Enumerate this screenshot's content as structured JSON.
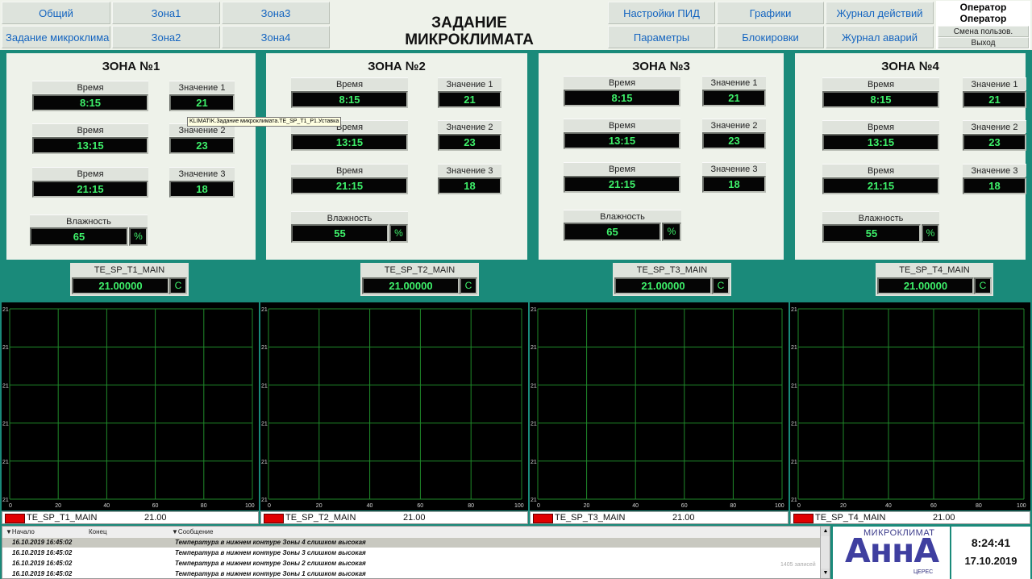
{
  "nav": {
    "general": "Общий",
    "zone1": "Зона1",
    "zone3": "Зона3",
    "microclimate_task": "Задание микроклима...",
    "zone2": "Зона2",
    "zone4": "Зона4",
    "pid_settings": "Настройки ПИД",
    "graphs": "Графики",
    "action_log": "Журнал действий",
    "parameters": "Параметры",
    "locks": "Блокировки",
    "alarm_log": "Журнал аварий"
  },
  "title": {
    "line1": "ЗАДАНИЕ",
    "line2": "МИКРОКЛИМАТА"
  },
  "user": {
    "line1": "Оператор",
    "line2": "Оператор",
    "change_user": "Смена пользов.",
    "logout": "Выход"
  },
  "labels": {
    "time": "Время",
    "value1": "Значение 1",
    "value2": "Значение 2",
    "value3": "Значение 3",
    "humidity": "Влажность",
    "percent": "%",
    "unit_c": "C"
  },
  "tooltip": "KLIMATIK.Задание микроклимата.TE_SP_T1_P1.Уставка",
  "zones": [
    {
      "title": "ЗОНА №1",
      "times": [
        "8:15",
        "13:15",
        "21:15"
      ],
      "values": [
        "21",
        "23",
        "18"
      ],
      "humidity": "65",
      "tag": "TE_SP_T1_MAIN",
      "tag_value": "21.00000",
      "legend_value": "21.00"
    },
    {
      "title": "ЗОНА №2",
      "times": [
        "8:15",
        "13:15",
        "21:15"
      ],
      "values": [
        "21",
        "23",
        "18"
      ],
      "humidity": "55",
      "tag": "TE_SP_T2_MAIN",
      "tag_value": "21.00000",
      "legend_value": "21.00"
    },
    {
      "title": "ЗОНА №3",
      "times": [
        "8:15",
        "13:15",
        "21:15"
      ],
      "values": [
        "21",
        "23",
        "18"
      ],
      "humidity": "65",
      "tag": "TE_SP_T3_MAIN",
      "tag_value": "21.00000",
      "legend_value": "21.00"
    },
    {
      "title": "ЗОНА №4",
      "times": [
        "8:15",
        "13:15",
        "21:15"
      ],
      "values": [
        "21",
        "23",
        "18"
      ],
      "humidity": "55",
      "tag": "TE_SP_T4_MAIN",
      "tag_value": "21.00000",
      "legend_value": "21.00"
    }
  ],
  "chart_data": [
    {
      "type": "line",
      "x_ticks": [
        "0",
        "20",
        "40",
        "60",
        "80",
        "100"
      ],
      "y_ticks": [
        "21",
        "21",
        "21",
        "21",
        "21",
        "21"
      ],
      "series": [
        {
          "name": "TE_SP_T1_MAIN",
          "values": []
        }
      ],
      "grid": true
    },
    {
      "type": "line",
      "x_ticks": [
        "0",
        "20",
        "40",
        "60",
        "80",
        "100"
      ],
      "y_ticks": [
        "21",
        "21",
        "21",
        "21",
        "21",
        "21"
      ],
      "series": [
        {
          "name": "TE_SP_T2_MAIN",
          "values": []
        }
      ],
      "grid": true
    },
    {
      "type": "line",
      "x_ticks": [
        "0",
        "20",
        "40",
        "60",
        "80",
        "100"
      ],
      "y_ticks": [
        "21",
        "21",
        "21",
        "21",
        "21",
        "21"
      ],
      "series": [
        {
          "name": "TE_SP_T3_MAIN",
          "values": []
        }
      ],
      "grid": true
    },
    {
      "type": "line",
      "x_ticks": [
        "0",
        "20",
        "40",
        "60",
        "80",
        "100"
      ],
      "y_ticks": [
        "21",
        "21",
        "21",
        "21",
        "21",
        "21"
      ],
      "series": [
        {
          "name": "TE_SP_T4_MAIN",
          "values": []
        }
      ],
      "grid": true
    }
  ],
  "alarms": {
    "headers": {
      "start": "Начало",
      "end": "Конец",
      "message": "Сообщение"
    },
    "rows": [
      {
        "start": "16.10.2019 16:45:02",
        "message": "Температура в нижнем контуре Зоны 4 слишком высокая"
      },
      {
        "start": "16.10.2019 16:45:02",
        "message": "Температура в нижнем контуре Зоны 3 слишком высокая"
      },
      {
        "start": "16.10.2019 16:45:02",
        "message": "Температура в нижнем контуре Зоны 2 слишком высокая"
      },
      {
        "start": "16.10.2019 16:45:02",
        "message": "Температура в нижнем контуре Зоны 1 слишком высокая"
      }
    ],
    "count": "1405",
    "count_suffix": "записей"
  },
  "logo": {
    "small": "МИКРОКЛИМАТ",
    "big": "АннА",
    "brand": "ЦЕРЕС"
  },
  "clock": {
    "time": "8:24:41",
    "date": "17.10.2019"
  },
  "colors": {
    "accent": "#1a8a7a",
    "value_text": "#3ef06a",
    "grid": "#1f8a2a",
    "legend_swatch": "#e00000"
  }
}
